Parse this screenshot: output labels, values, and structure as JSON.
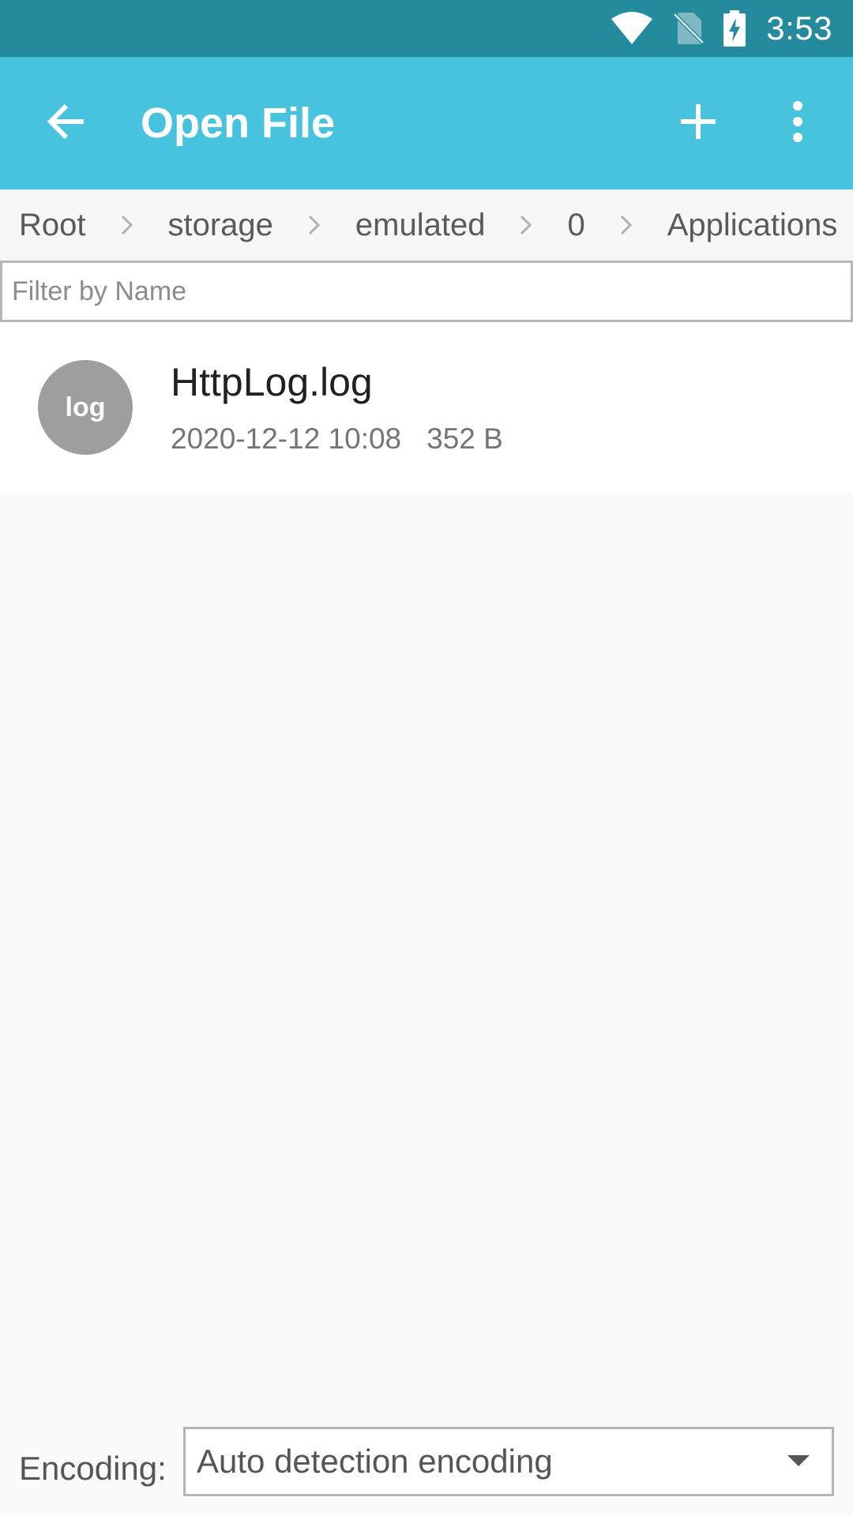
{
  "status_bar": {
    "time": "3:53",
    "icons": [
      "wifi-icon",
      "no-sim-icon",
      "battery-charging-icon"
    ]
  },
  "app_bar": {
    "title": "Open File",
    "back_icon": "arrow-back-icon",
    "add_icon": "plus-icon",
    "more_icon": "more-vert-icon",
    "color": "#48c3de",
    "status_color": "#238b9b"
  },
  "breadcrumb": {
    "items": [
      "Root",
      "storage",
      "emulated",
      "0",
      "Applications"
    ],
    "separator_icon": "chevron-right-icon"
  },
  "filter": {
    "placeholder": "Filter by Name",
    "value": ""
  },
  "files": [
    {
      "icon_label": "log",
      "name": "HttpLog.log",
      "date": "2020-12-12 10:08",
      "size": "352 B"
    }
  ],
  "encoding": {
    "label": "Encoding:",
    "value": "Auto detection encoding",
    "arrow_icon": "dropdown-arrow-icon"
  }
}
